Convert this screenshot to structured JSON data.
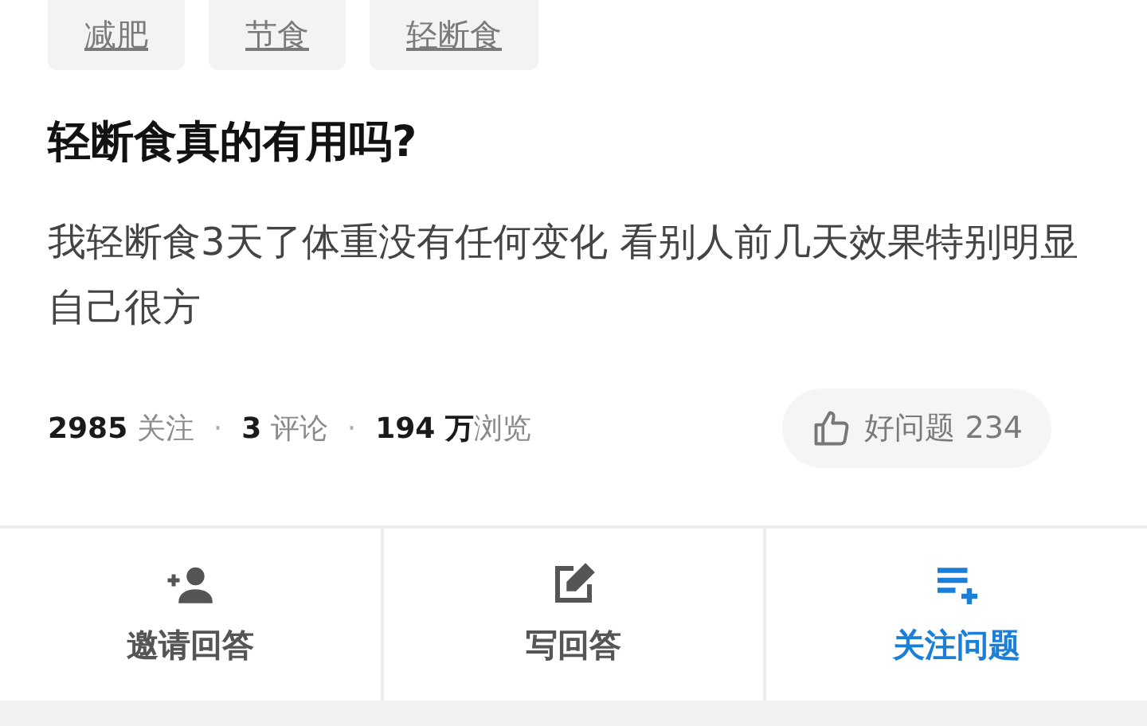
{
  "tags": [
    "减肥",
    "节食",
    "轻断食"
  ],
  "title": "轻断食真的有用吗?",
  "description": "我轻断食3天了体重没有任何变化 看别人前几天效果特别明显自己很方",
  "stats": [
    {
      "kind": "stat",
      "text": "**2985** 关注"
    },
    {
      "kind": "separator",
      "text": "·"
    },
    {
      "kind": "stat",
      "text": "**3** 评论"
    },
    {
      "kind": "separator",
      "text": "·"
    },
    {
      "kind": "stat",
      "text": "**194 万**浏览"
    }
  ],
  "like_button": {
    "label": "好问题 234"
  },
  "actions": [
    {
      "kind": "invite",
      "label": "邀请回答",
      "color": "#555555"
    },
    {
      "kind": "write",
      "label": "写回答",
      "color": "#555555"
    },
    {
      "kind": "follow",
      "label": "关注问题",
      "color": "#1a7fd9"
    }
  ]
}
